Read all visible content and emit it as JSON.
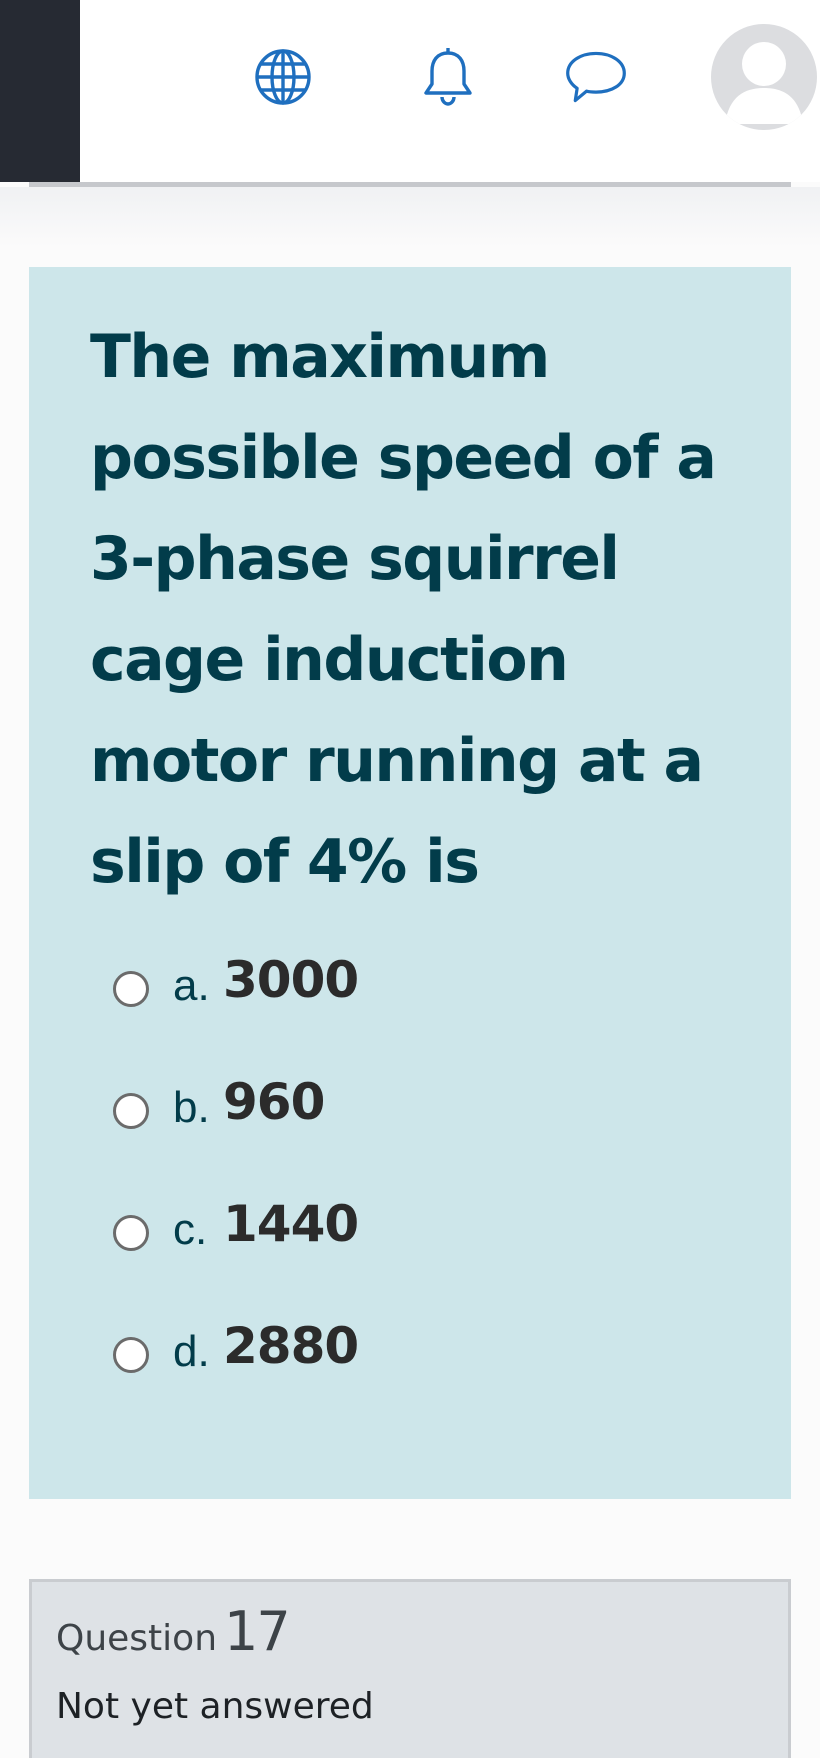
{
  "navbar": {
    "icons": {
      "language": "globe-icon",
      "notifications": "bell-icon",
      "messages": "chat-bubble-icon",
      "user": "avatar"
    },
    "colors": {
      "icon": "#1f6fbf",
      "dark_block": "#262a33"
    }
  },
  "question": {
    "text": "The maximum possible speed of a 3-phase squirrel cage induction motor running at a slip of 4% is",
    "background": "#cde6ea",
    "text_color": "#023c4a",
    "answers": [
      {
        "letter": "a.",
        "value": "3000",
        "selected": false
      },
      {
        "letter": "b.",
        "value": "960",
        "selected": false
      },
      {
        "letter": "c.",
        "value": "1440",
        "selected": false
      },
      {
        "letter": "d.",
        "value": "2880",
        "selected": false
      }
    ]
  },
  "next_question": {
    "label": "Question",
    "number": "17",
    "status": "Not yet answered"
  }
}
